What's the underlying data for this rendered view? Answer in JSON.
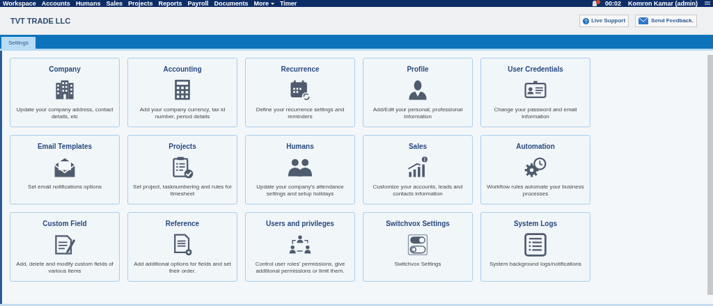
{
  "top_nav": {
    "items": [
      "Workspace",
      "Accounts",
      "Humans",
      "Sales",
      "Projects",
      "Reports",
      "Payroll",
      "Documents",
      "More",
      "Timer"
    ],
    "time": "00:02",
    "user": "Komron Kamar (admin)"
  },
  "header": {
    "title": "TVT TRADE LLC",
    "buttons": [
      "Live Support",
      "Send Feedback."
    ]
  },
  "tabs": [
    {
      "label": "Settings",
      "selected": true
    }
  ],
  "cards": [
    {
      "title": "Company",
      "description": "Update your company address, contact details, etc"
    },
    {
      "title": "Accounting",
      "description": "Add your company currency, tax id number, period details"
    },
    {
      "title": "Recurrence",
      "description": "Define your recurrence settings and reminders"
    },
    {
      "title": "Profile",
      "description": "Add/Edit your personal, professional Information"
    },
    {
      "title": "User Credentials",
      "description": "Change your password and email information"
    },
    {
      "title": "Email Templates",
      "description": "Set email notifications options"
    },
    {
      "title": "Projects",
      "description": "Set project, tasknumbering and rules for timesheet"
    },
    {
      "title": "Humans",
      "description": "Update your company's attendance settings and setup holidays"
    },
    {
      "title": "Sales",
      "description": "Customize your accounts, leads and contacts information"
    },
    {
      "title": "Automation",
      "description": "Workflow rules automate your business processes"
    },
    {
      "title": "Custom Field",
      "description": "Add, delete and modify custom fields of various items"
    },
    {
      "title": "Reference",
      "description": "Add additional options for fields and set their order."
    },
    {
      "title": "Users and privileges",
      "description": "Control user roles' permissions, give additional permissions or limit them."
    },
    {
      "title": "Switchvox Settings",
      "description": "Switchvox Settings"
    },
    {
      "title": "System Logs",
      "description": "System background logs/notifications"
    }
  ]
}
